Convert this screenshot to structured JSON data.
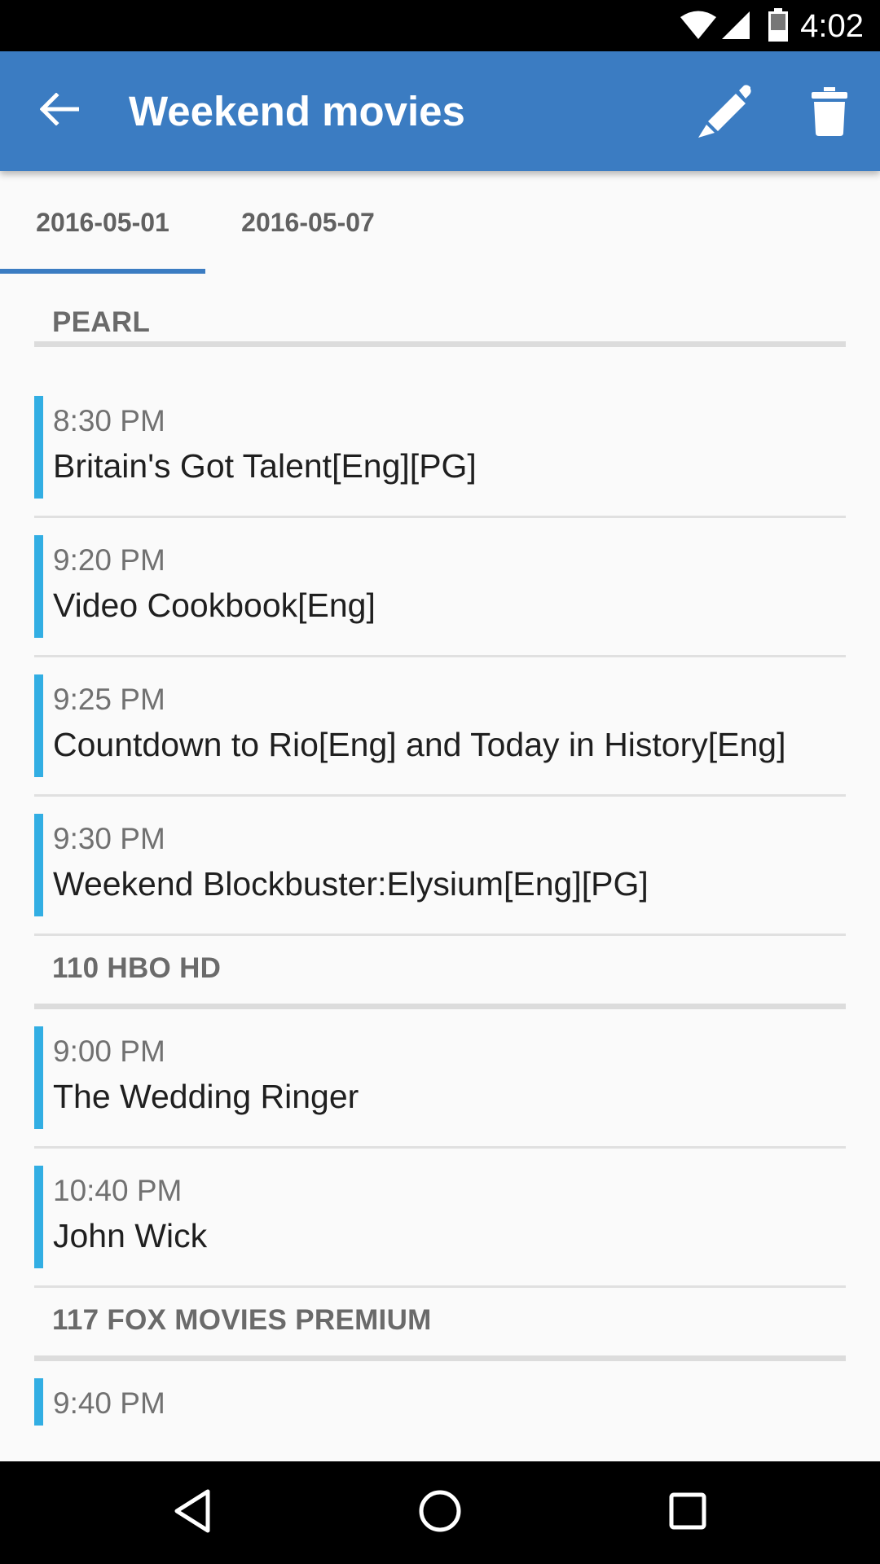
{
  "status_bar": {
    "time": "4:02",
    "icons": [
      "wifi-icon",
      "signal-icon",
      "battery-icon"
    ]
  },
  "app_bar": {
    "title": "Weekend movies",
    "back_icon": "arrow-left-icon",
    "actions": [
      "pencil-icon",
      "trash-icon"
    ],
    "color": "#3b7cc2"
  },
  "tabs": [
    {
      "label": "2016-05-01",
      "selected": true
    },
    {
      "label": "2016-05-07",
      "selected": false
    }
  ],
  "channels": [
    {
      "name": "PEARL",
      "programs": [
        {
          "time": "8:30 PM",
          "title": "Britain's Got Talent[Eng][PG]"
        },
        {
          "time": "9:20 PM",
          "title": "Video Cookbook[Eng]"
        },
        {
          "time": "9:25 PM",
          "title": "Countdown to Rio[Eng] and Today in History[Eng]"
        },
        {
          "time": "9:30 PM",
          "title": "Weekend Blockbuster:Elysium[Eng][PG]"
        }
      ]
    },
    {
      "name": "110 HBO HD",
      "programs": [
        {
          "time": "9:00 PM",
          "title": "The Wedding Ringer"
        },
        {
          "time": "10:40 PM",
          "title": "John Wick"
        }
      ]
    },
    {
      "name": "117 FOX MOVIES PREMIUM",
      "programs": [
        {
          "time": "9:40 PM",
          "title": ""
        }
      ]
    }
  ],
  "accent_color": "#32aee3",
  "nav_bar": {
    "icons": [
      "back-triangle-icon",
      "home-circle-icon",
      "recents-square-icon"
    ]
  }
}
